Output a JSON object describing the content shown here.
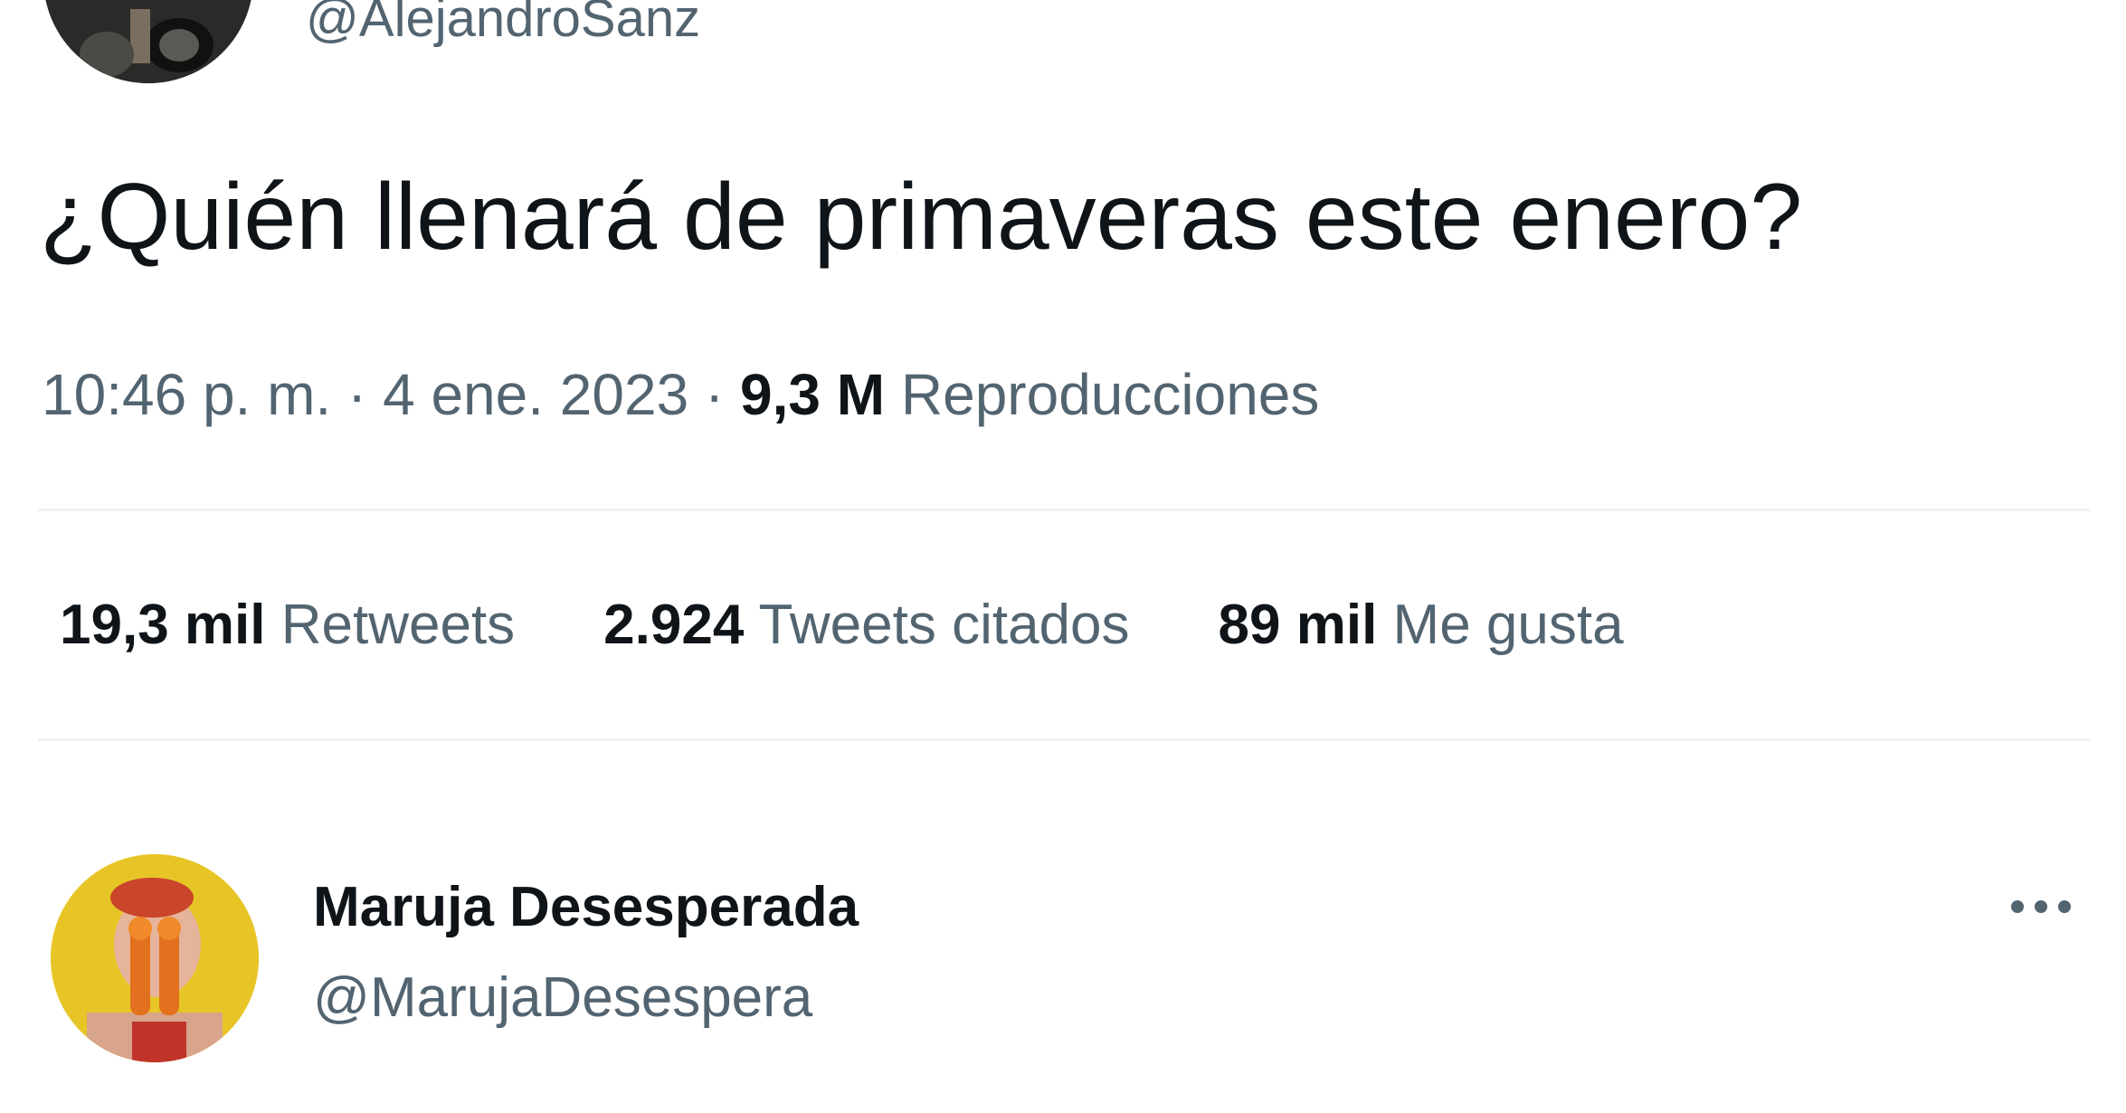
{
  "tweet": {
    "author_handle": "@AlejandroSanz",
    "text": "¿Quién llenará de primaveras este enero?",
    "time": "10:46 p. m.",
    "separator": " · ",
    "date": "4 ene. 2023",
    "views_count": "9,3 M",
    "views_label": "Reproducciones"
  },
  "stats": {
    "retweets_count": "19,3 mil",
    "retweets_label": "Retweets",
    "quotes_count": "2.924",
    "quotes_label": "Tweets citados",
    "likes_count": "89 mil",
    "likes_label": "Me gusta"
  },
  "reply": {
    "name": "Maruja Desesperada",
    "handle": "@MarujaDesespera",
    "more_icon": "more-horizontal-icon"
  },
  "colors": {
    "text_primary": "#0f1419",
    "text_secondary": "#536471",
    "divider": "#eff3f4"
  }
}
